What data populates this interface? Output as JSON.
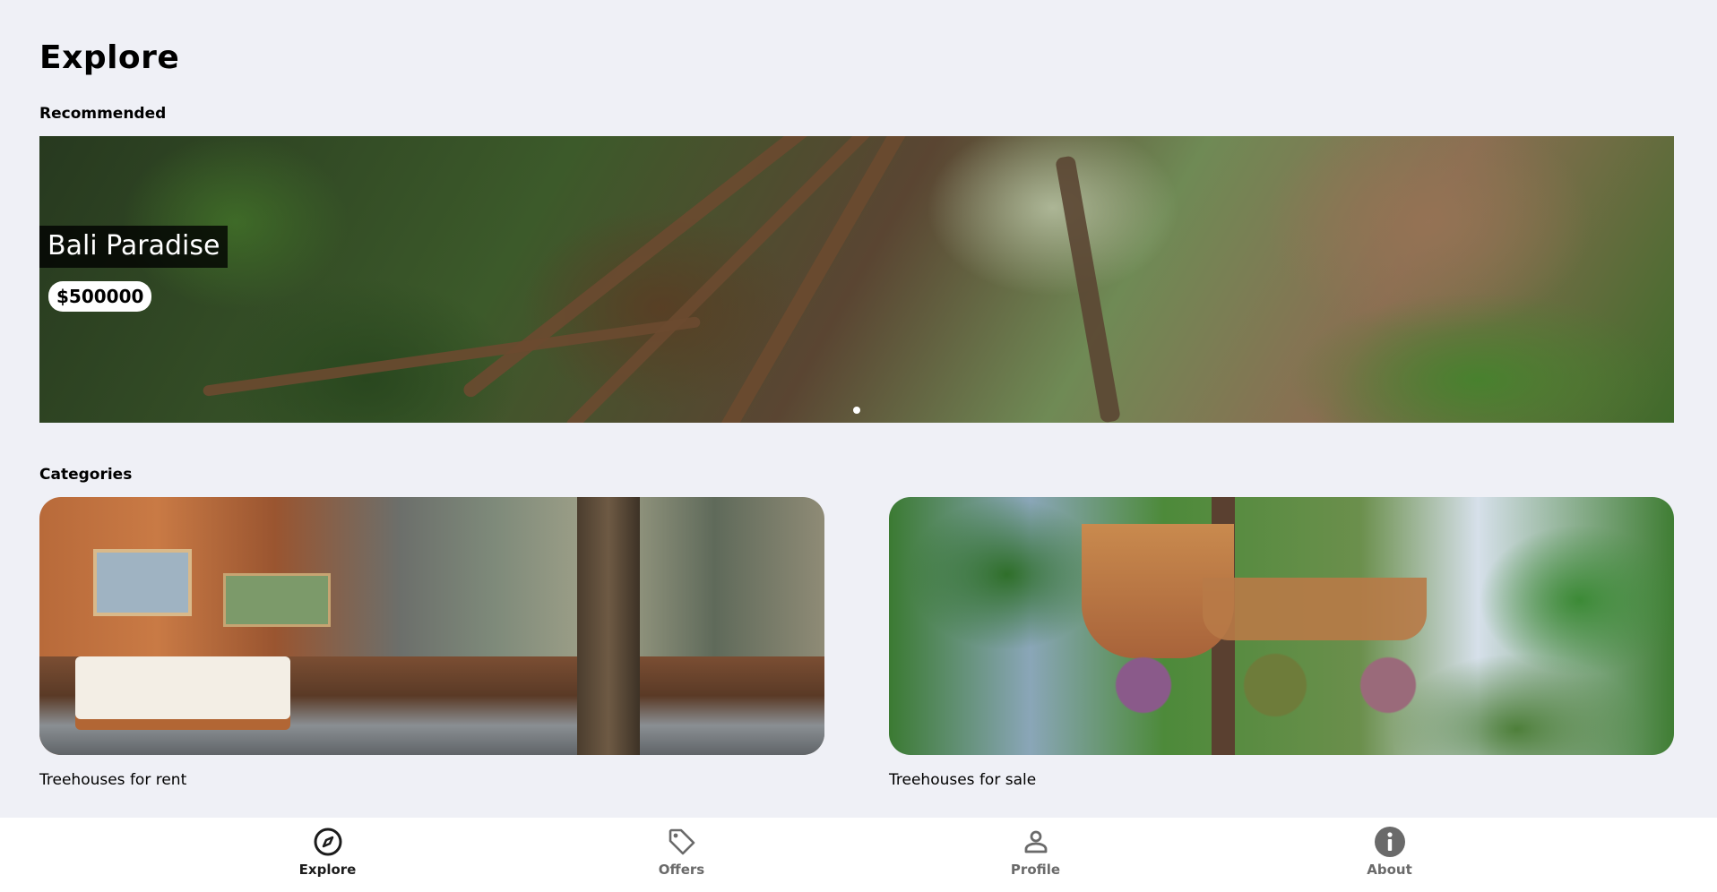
{
  "page": {
    "title": "Explore"
  },
  "recommended": {
    "label": "Recommended",
    "hero": {
      "title": "Bali Paradise",
      "price": "$500000",
      "active_slide": 1,
      "slide_count": 1
    }
  },
  "categories": {
    "label": "Categories",
    "items": [
      {
        "label": "Treehouses for rent"
      },
      {
        "label": "Treehouses for sale"
      }
    ]
  },
  "bottom_nav": {
    "items": [
      {
        "label": "Explore",
        "icon": "compass-icon",
        "active": true
      },
      {
        "label": "Offers",
        "icon": "tag-icon",
        "active": false
      },
      {
        "label": "Profile",
        "icon": "person-icon",
        "active": false
      },
      {
        "label": "About",
        "icon": "info-icon",
        "active": false
      }
    ]
  },
  "colors": {
    "background": "#eff0f6",
    "nav_background": "#ffffff",
    "active": "#1c1c1c",
    "inactive": "#6a6a6a"
  }
}
